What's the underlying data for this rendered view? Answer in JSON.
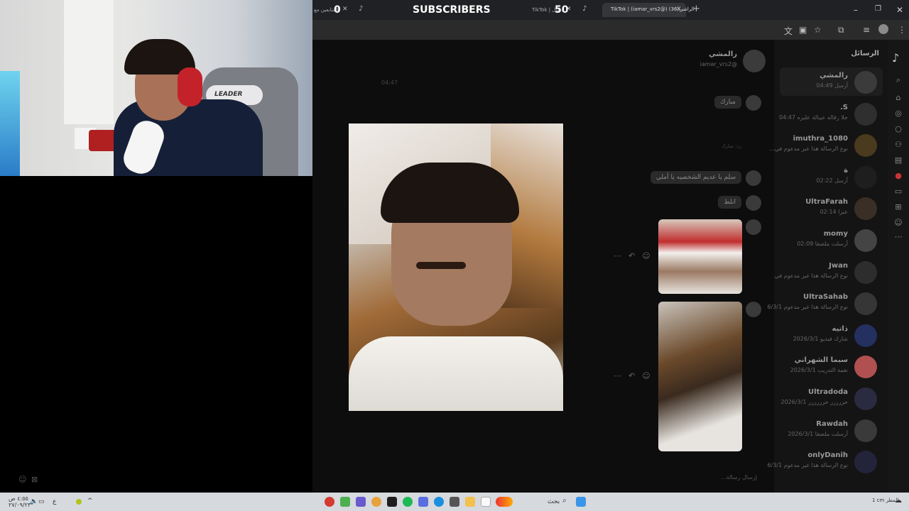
{
  "overlay": {
    "left_count": "0",
    "right_count": "50",
    "subscribers_label": "SUBSCRIBERS",
    "left_tab_text": "المتابعين مع",
    "middle_tab_text": "TikTok | مال...",
    "chair_brand": "LEADER"
  },
  "browser": {
    "tab_title": "TikTok | (iamar_vrs2@) الراشي(36)",
    "new_tab_label": "+",
    "window": {
      "minimize": "–",
      "maximize": "❐",
      "close": "✕"
    }
  },
  "tiktok": {
    "messages_title": "الرسائل",
    "chat_header": {
      "name": "رالمشي",
      "handle": "iamar_vrs2@"
    },
    "timestamp": "04:47",
    "input_placeholder": "إرسال رسالة...",
    "messages": [
      {
        "text": "مبارك"
      },
      {
        "text": "رد: مبارك"
      },
      {
        "text": "سلم يا عديم الشخصيه يا أملي"
      },
      {
        "text": "انلط"
      }
    ],
    "conversations": [
      {
        "name": "رالمشي",
        "sub": "أرسل  04:49"
      },
      {
        "name": "S.",
        "sub": "جلا رقاله عيبالة عليره  04:47"
      },
      {
        "name": "imuthra_1080",
        "sub": "نوع الرسالة هذا غير مدعوم في..."
      },
      {
        "name": "ة",
        "sub": "أرسل  02:22"
      },
      {
        "name": "UltraFarah",
        "sub": "عبرا  02:14"
      },
      {
        "name": "momy",
        "sub": "أرسلت ملصقا  02:09"
      },
      {
        "name": "Jwan",
        "sub": "نوع الرسالة هذا غير مدعوم في"
      },
      {
        "name": "UltraSahab",
        "sub": "نوع الرسالة هذا غير مدعوم  6/3/1"
      },
      {
        "name": "ذاتيه",
        "sub": "شارك فيديو  2026/3/1"
      },
      {
        "name": "سبما الشهراني",
        "sub": "نغمة التدريب  2026/3/1"
      },
      {
        "name": "Ultradoda",
        "sub": "حررررر حرررررر  2026/3/1"
      },
      {
        "name": "Rawdah",
        "sub": "أرسلت ملصقا  2026/3/1"
      },
      {
        "name": "onlyDanih",
        "sub": "نوع الرسالة هذا غير مدعوم  6/3/1"
      }
    ]
  },
  "taskbar": {
    "search_label": "بحث",
    "weather": "1 cm المطر",
    "clock_time": "٤:٥٥ ص",
    "clock_date": "٢٧/٠٩/٢٣"
  }
}
